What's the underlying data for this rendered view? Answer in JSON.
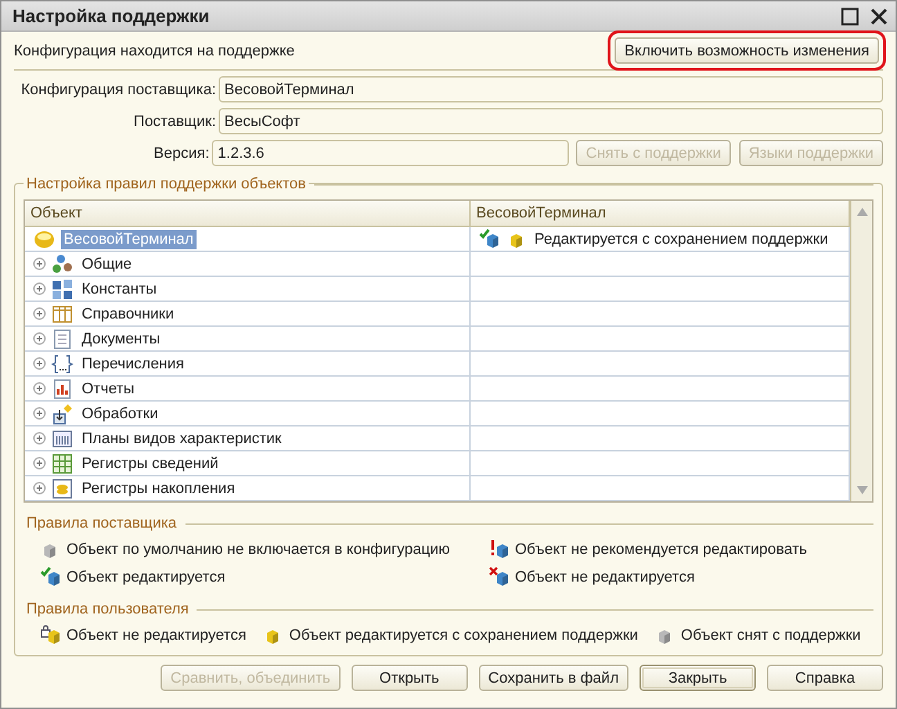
{
  "window": {
    "title": "Настройка поддержки"
  },
  "status": {
    "text": "Конфигурация находится на поддержке",
    "button": {
      "label": "Включить возможность изменения",
      "highlighted": true
    }
  },
  "fields": [
    {
      "label": "Конфигурация поставщика:",
      "value": "ВесовойТерминал"
    },
    {
      "label": "Поставщик:",
      "value": "ВесыСофт"
    },
    {
      "label": "Версия:",
      "value": "1.2.3.6"
    }
  ],
  "version_buttons": [
    {
      "label": "Снять с поддержки",
      "disabled": true
    },
    {
      "label": "Языки поддержки",
      "disabled": true
    }
  ],
  "rules_group": {
    "title": "Настройка правил поддержки объектов",
    "columns": [
      "Объект",
      "ВесовойТерминал"
    ],
    "rows": [
      {
        "name": "ВесовойТерминал",
        "kind": "root",
        "selected": true,
        "rule": "Редактируется с сохранением поддержки"
      },
      {
        "name": "Общие",
        "kind": "common",
        "selected": false,
        "expanded": false
      },
      {
        "name": "Константы",
        "kind": "constants",
        "selected": false,
        "expanded": false
      },
      {
        "name": "Справочники",
        "kind": "catalogs",
        "selected": false,
        "expanded": false
      },
      {
        "name": "Документы",
        "kind": "documents",
        "selected": false,
        "expanded": false
      },
      {
        "name": "Перечисления",
        "kind": "enums",
        "selected": false,
        "expanded": false
      },
      {
        "name": "Отчеты",
        "kind": "reports",
        "selected": false,
        "expanded": false
      },
      {
        "name": "Обработки",
        "kind": "processing",
        "selected": false,
        "expanded": false
      },
      {
        "name": "Планы видов характеристик",
        "kind": "plans",
        "selected": false,
        "expanded": false
      },
      {
        "name": "Регистры сведений",
        "kind": "inforeg",
        "selected": false,
        "expanded": false
      },
      {
        "name": "Регистры накопления",
        "kind": "accumreg",
        "selected": false,
        "expanded": false
      }
    ]
  },
  "provider_rules": {
    "title": "Правила поставщика",
    "items": [
      {
        "kind": "excluded",
        "text": "Объект по умолчанию не включается в конфигурацию"
      },
      {
        "kind": "not_recommended",
        "text": "Объект не рекомендуется редактировать"
      },
      {
        "kind": "editable",
        "text": "Объект редактируется"
      },
      {
        "kind": "not_editable",
        "text": "Объект не редактируется"
      }
    ]
  },
  "user_rules": {
    "title": "Правила пользователя",
    "items": [
      {
        "kind": "locked",
        "text": "Объект не редактируется"
      },
      {
        "kind": "kept",
        "text": "Объект редактируется с сохранением поддержки"
      },
      {
        "kind": "removed",
        "text": "Объект снят с поддержки"
      }
    ]
  },
  "buttons": [
    {
      "label": "Сравнить, объединить",
      "disabled": true,
      "default": false
    },
    {
      "label": "Открыть",
      "disabled": false,
      "default": false
    },
    {
      "label": "Сохранить в файл",
      "disabled": false,
      "default": false
    },
    {
      "label": "Закрыть",
      "disabled": false,
      "default": true
    },
    {
      "label": "Справка",
      "disabled": false,
      "default": false
    }
  ]
}
